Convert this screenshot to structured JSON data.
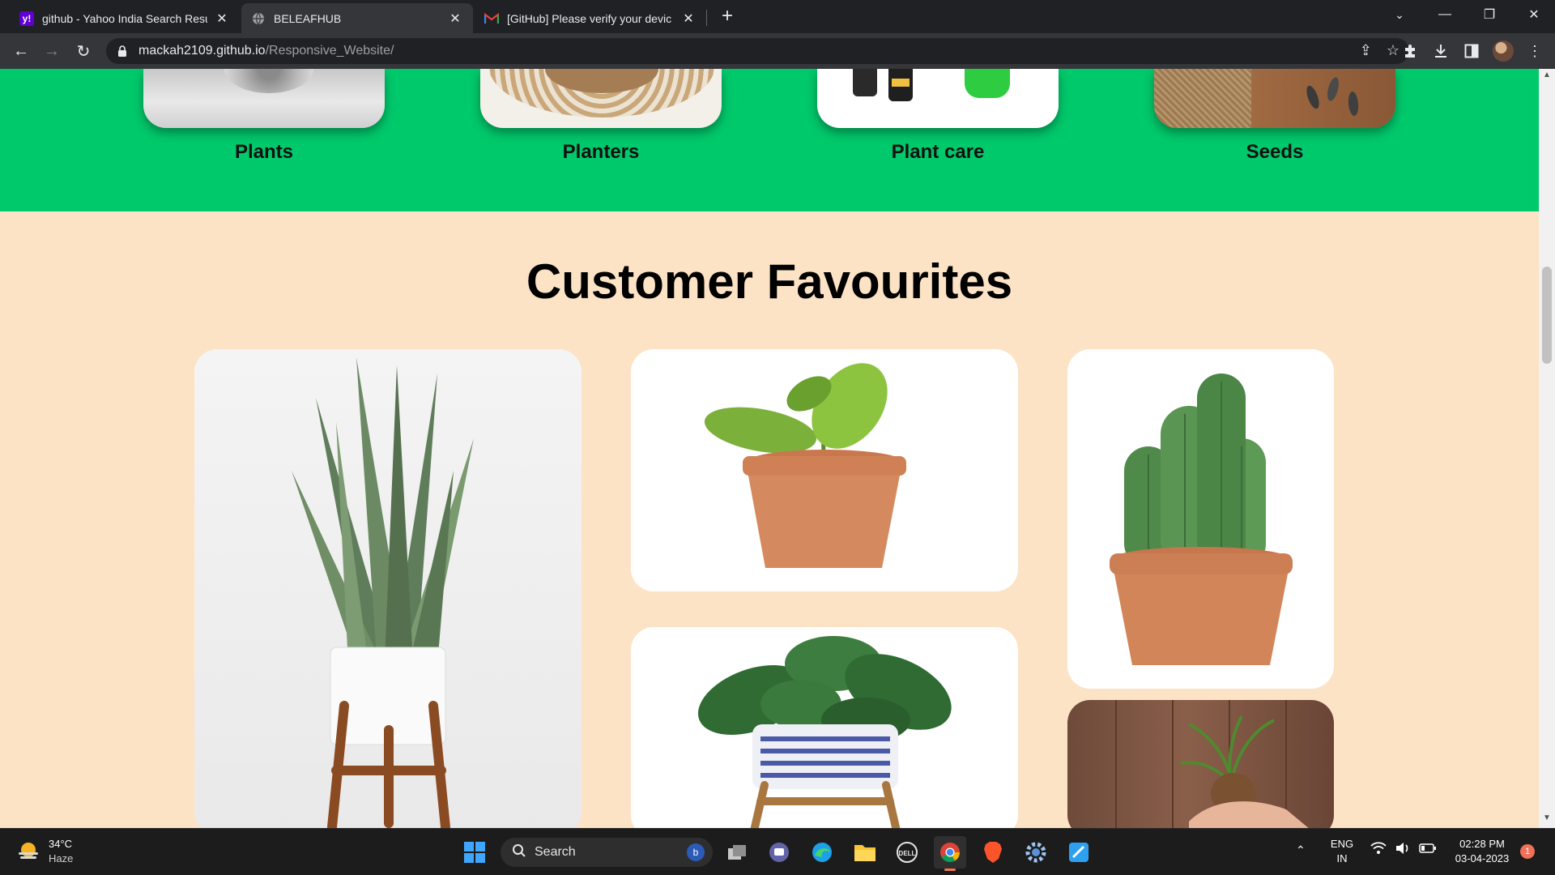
{
  "browser": {
    "tabs": [
      {
        "title": "github - Yahoo India Search Resu",
        "favicon": "yahoo-icon",
        "active": false
      },
      {
        "title": "BELEAFHUB",
        "favicon": "globe-icon",
        "active": true
      },
      {
        "title": "[GitHub] Please verify your devic",
        "favicon": "gmail-icon",
        "active": false
      }
    ],
    "new_tab": "+",
    "url_host": "mackah2109.github.io",
    "url_path": "/Responsive_Website/"
  },
  "page": {
    "categories": [
      {
        "label": "Plants"
      },
      {
        "label": "Planters"
      },
      {
        "label": "Plant care"
      },
      {
        "label": "Seeds"
      }
    ],
    "favourites_title": "Customer Favourites"
  },
  "taskbar": {
    "weather_temp": "34°C",
    "weather_desc": "Haze",
    "search_label": "Search",
    "lang_top": "ENG",
    "lang_bottom": "IN",
    "time": "02:28 PM",
    "date": "03-04-2023",
    "notification_count": "1"
  },
  "colors": {
    "category_band": "#00c96b",
    "page_background": "#fde3c5",
    "chrome_dark": "#202124",
    "chrome_toolbar": "#35363a"
  }
}
